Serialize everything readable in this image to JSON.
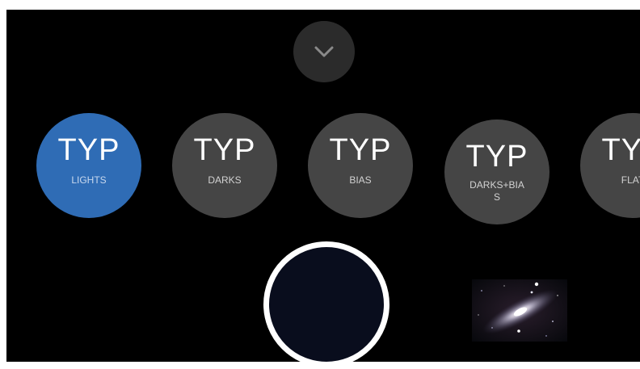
{
  "collapse_button": {
    "icon": "chevron-down-icon"
  },
  "frame_types": [
    {
      "abbr": "TYP",
      "label": "LIGHTS",
      "selected": true
    },
    {
      "abbr": "TYP",
      "label": "DARKS",
      "selected": false
    },
    {
      "abbr": "TYP",
      "label": "BIAS",
      "selected": false
    },
    {
      "abbr": "TYP",
      "label": "DARKS+BIAS",
      "selected": false
    },
    {
      "abbr": "TYP",
      "label": "FLAT",
      "selected": false
    }
  ],
  "colors": {
    "background": "#000000",
    "selected": "#2f6cb5",
    "unselected": "#454545",
    "shutter_ring": "#ffffff",
    "shutter_fill": "#090d1d"
  },
  "shutter": {
    "icon": "shutter-button"
  },
  "last_capture": {
    "icon": "galaxy-thumbnail"
  }
}
